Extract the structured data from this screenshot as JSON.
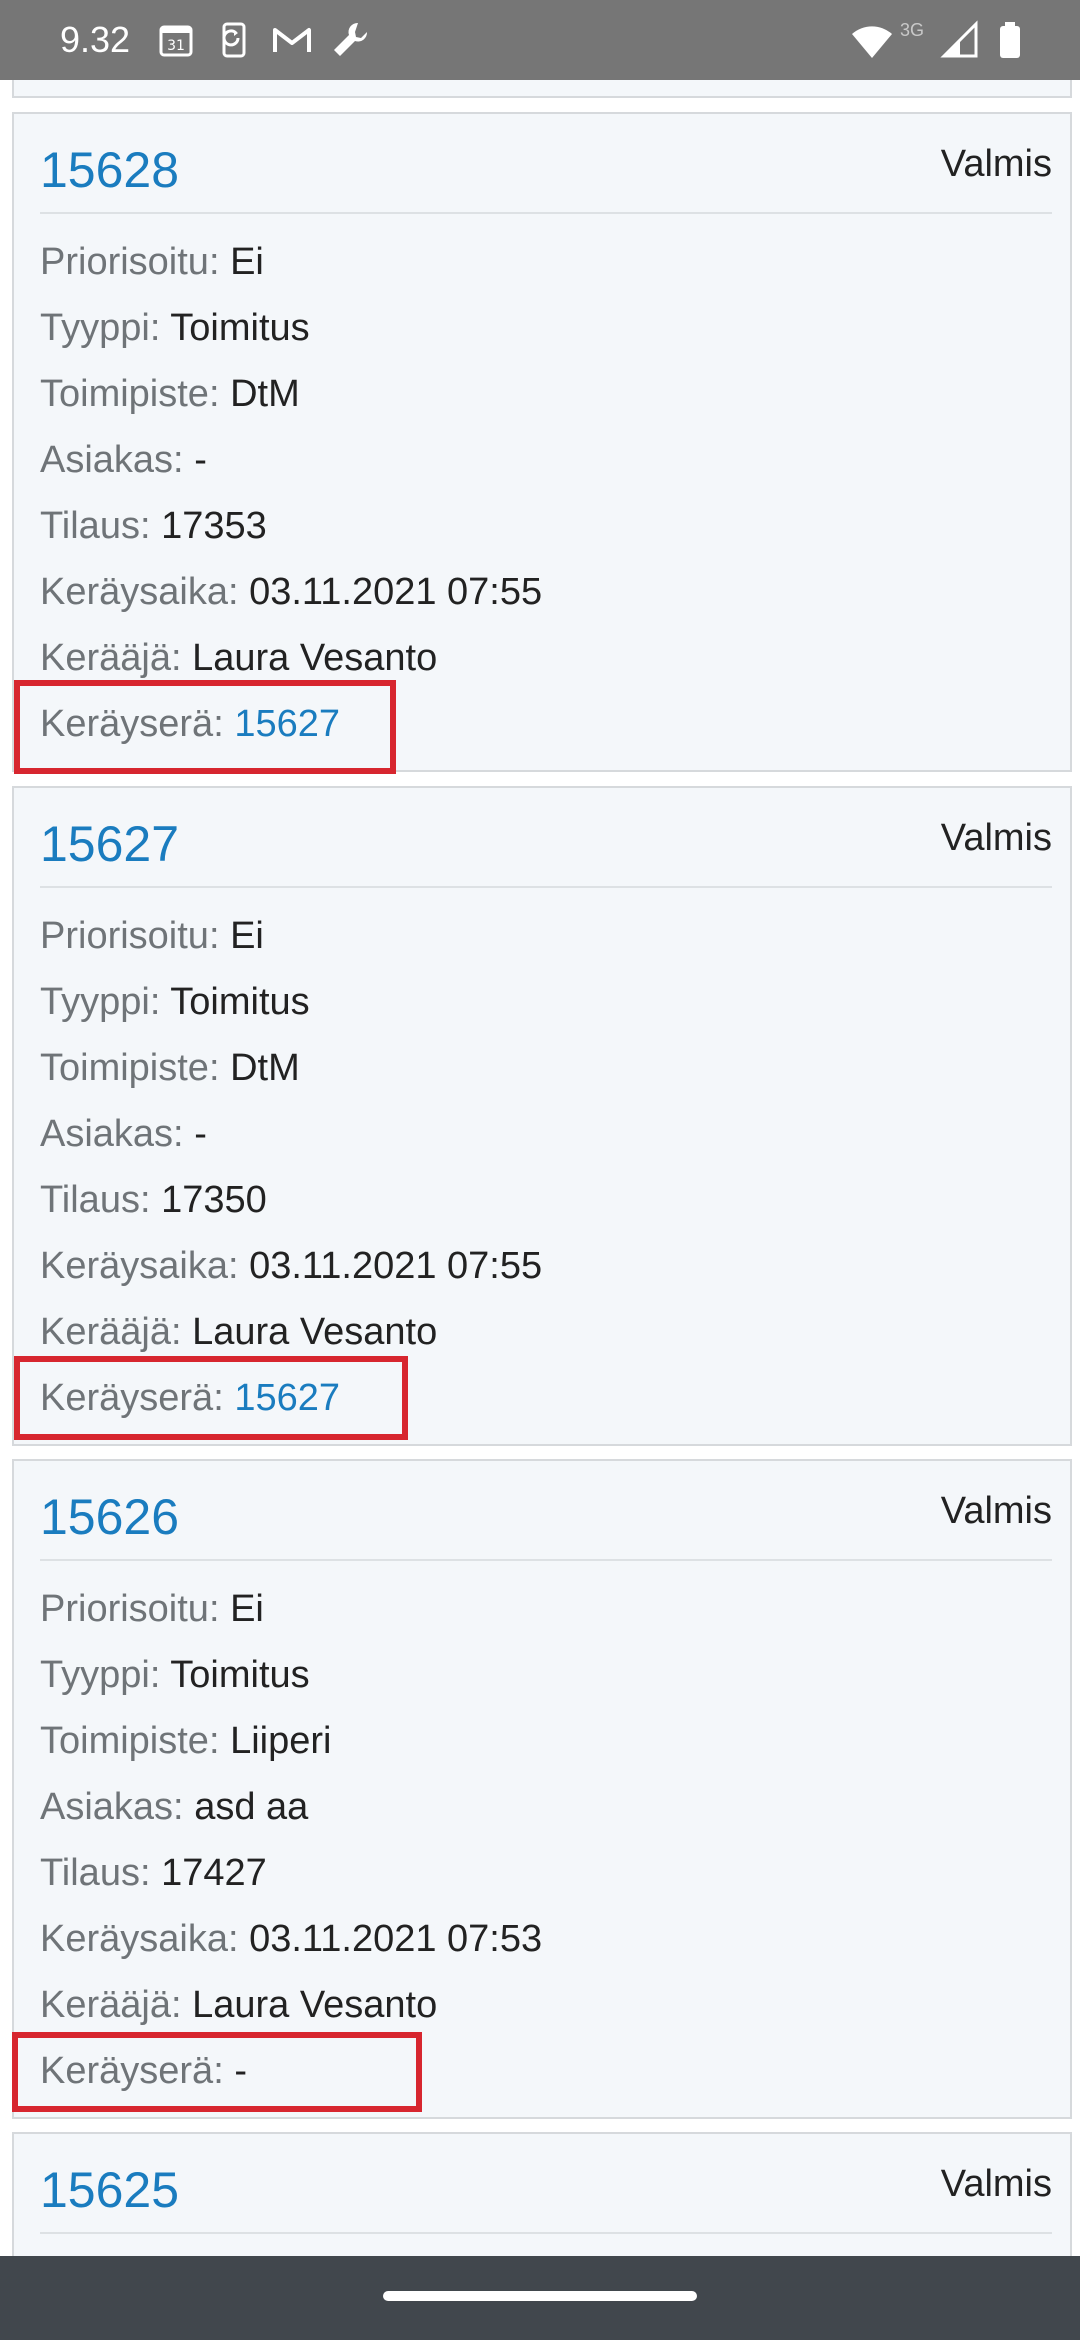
{
  "status_bar": {
    "time": "9.32",
    "calendar_day": "31",
    "network_label": "3G",
    "icons": [
      "calendar-icon",
      "sync-icon",
      "gmail-icon",
      "wrench-icon",
      "wifi-icon",
      "signal-icon",
      "battery-icon"
    ]
  },
  "labels": {
    "prioritized": "Priorisoitu:",
    "type": "Tyyppi:",
    "office": "Toimipiste:",
    "customer": "Asiakas:",
    "order": "Tilaus:",
    "pick_time": "Keräysaika:",
    "picker": "Kerääjä:",
    "batch": "Keräyserä:"
  },
  "cards": [
    {
      "id": "15628",
      "status": "Valmis",
      "prioritized": "Ei",
      "type": "Toimitus",
      "office": "DtM",
      "customer": "-",
      "order": "17353",
      "pick_time": "03.11.2021 07:55",
      "picker": "Laura Vesanto",
      "batch": "15627"
    },
    {
      "id": "15627",
      "status": "Valmis",
      "prioritized": "Ei",
      "type": "Toimitus",
      "office": "DtM",
      "customer": "-",
      "order": "17350",
      "pick_time": "03.11.2021 07:55",
      "picker": "Laura Vesanto",
      "batch": "15627"
    },
    {
      "id": "15626",
      "status": "Valmis",
      "prioritized": "Ei",
      "type": "Toimitus",
      "office": "Liiperi",
      "customer": "asd aa",
      "order": "17427",
      "pick_time": "03.11.2021 07:53",
      "picker": "Laura Vesanto",
      "batch": "-"
    },
    {
      "id": "15625",
      "status": "Valmis"
    }
  ],
  "colors": {
    "accent": "#1a7cbf",
    "highlight": "#d7262f",
    "card_bg": "#f4f7fa",
    "status_bar": "#767676",
    "nav_bar": "#41474d"
  }
}
